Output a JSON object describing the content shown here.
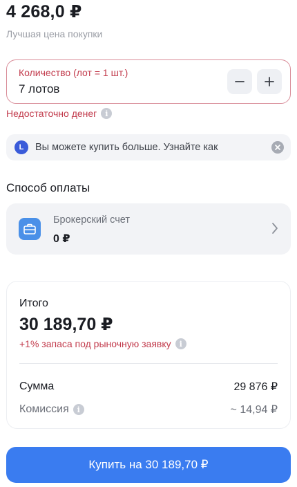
{
  "header": {
    "price": "4 268,0 ₽",
    "price_caption": "Лучшая цена покупки"
  },
  "quantity": {
    "label": "Количество (лот = 1 шт.)",
    "value": "7 лотов",
    "minus_icon": "minus-icon",
    "plus_icon": "plus-icon"
  },
  "warning": {
    "text": "Недостаточно денег",
    "icon": "info-icon"
  },
  "promo": {
    "badge": "L",
    "text": "Вы можете купить больше. Узнайте как",
    "close_icon": "close-icon"
  },
  "payment": {
    "section_title": "Способ оплаты",
    "account_title": "Брокерский счет",
    "account_amount": "0 ₽",
    "icon": "briefcase-icon"
  },
  "total": {
    "label": "Итого",
    "value": "30 189,70 ₽",
    "note": "+1% запаса под рыночную заявку",
    "sum_label": "Сумма",
    "sum_value": "29 876 ₽",
    "fee_label": "Комиссия",
    "fee_value": "~ 14,94 ₽"
  },
  "buy_button": {
    "label": "Купить на 30 189,70 ₽"
  },
  "colors": {
    "accent": "#3a7cf0",
    "error": "#c23b4c",
    "card_bg": "#f2f3f6"
  }
}
